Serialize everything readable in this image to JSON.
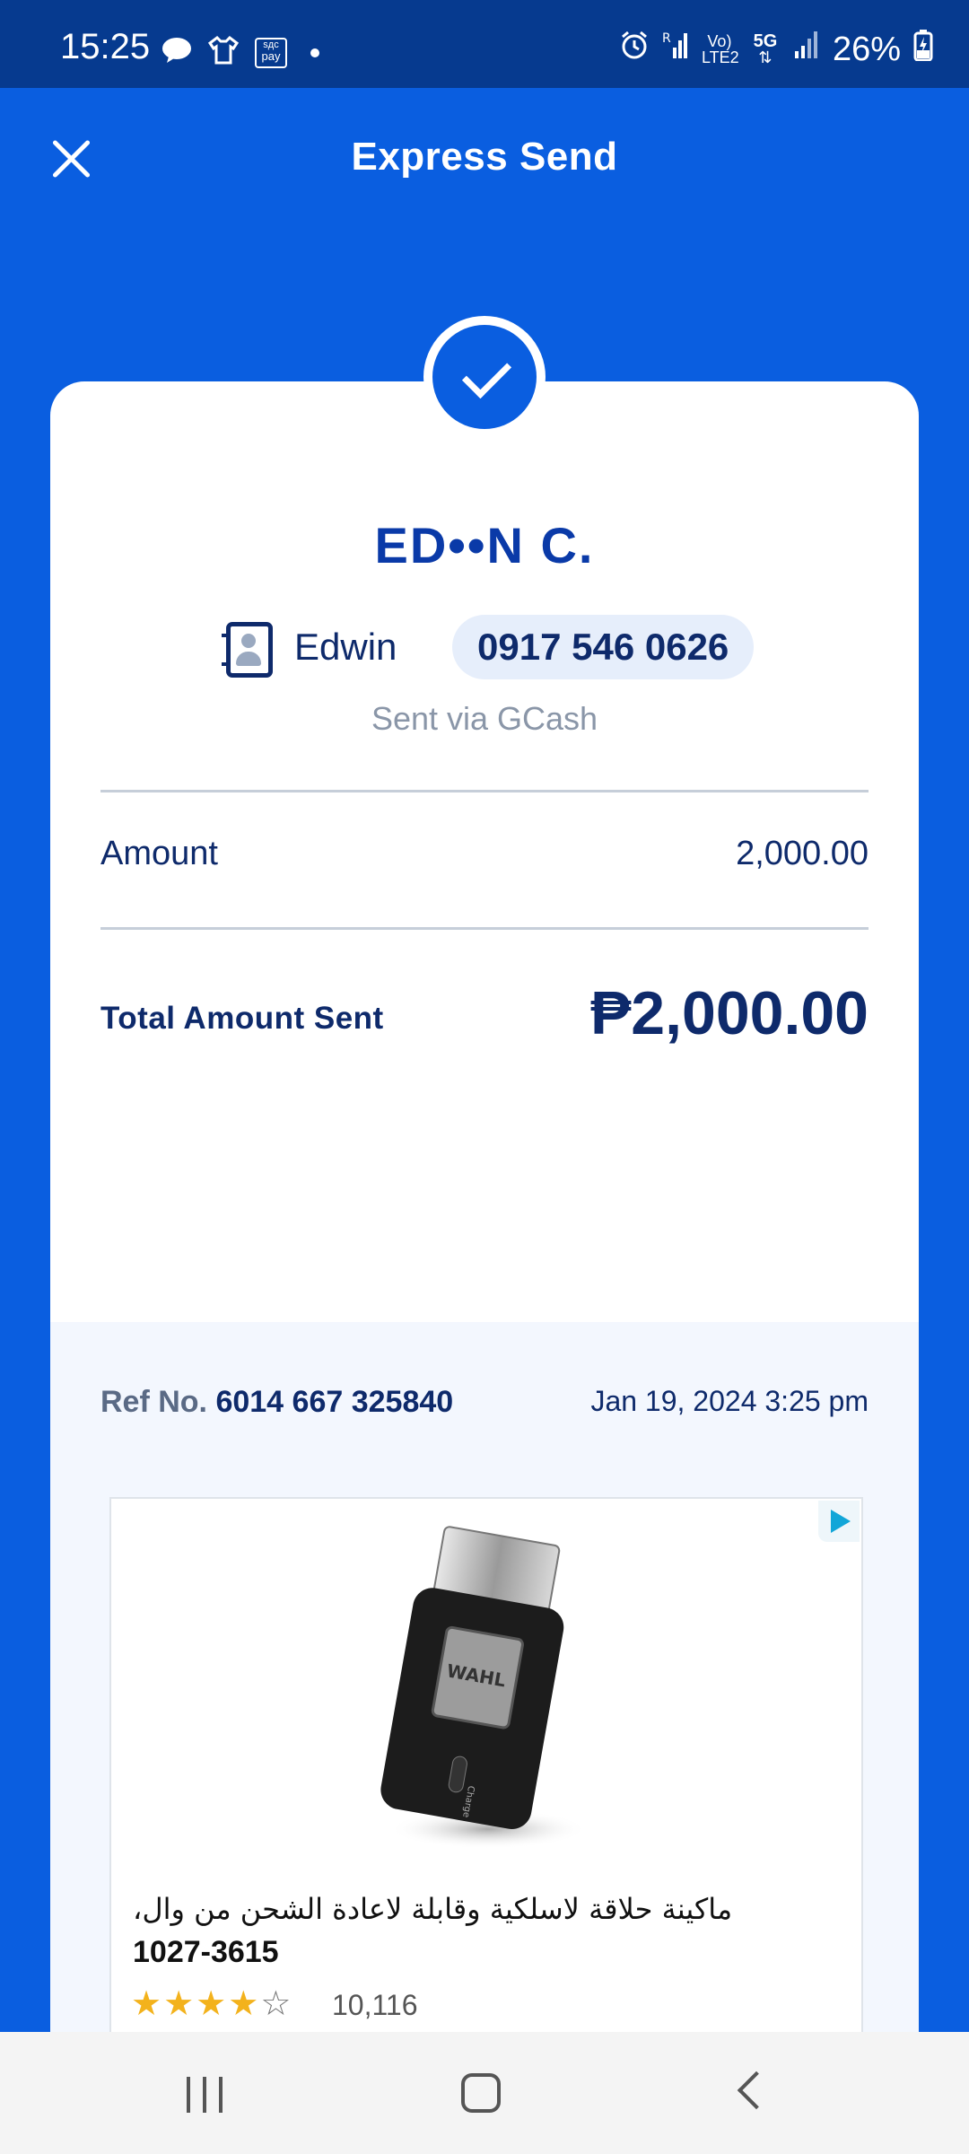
{
  "status_bar": {
    "time": "15:25",
    "battery": "26%",
    "left_icons": [
      "chat-icon",
      "shirt-icon",
      "pay-icon",
      "dot-icon"
    ],
    "right_icons": [
      "alarm-icon",
      "signal-r-icon",
      "volte-icon",
      "5g-icon",
      "signal-icon",
      "battery-charging-icon"
    ],
    "pay_label": "pay",
    "pay_top": "sдc",
    "volte_top": "Vo)",
    "volte_bottom": "LTE2",
    "net": "5G"
  },
  "header": {
    "title": "Express Send"
  },
  "recipient": {
    "masked_name": "ED••N C.",
    "contact_name": "Edwin",
    "phone": "0917 546 0626",
    "sent_via": "Sent via GCash"
  },
  "amount": {
    "label": "Amount",
    "value": "2,000.00"
  },
  "total": {
    "label": "Total Amount Sent",
    "value": "₱2,000.00"
  },
  "reference": {
    "label": "Ref No.",
    "number": "6014 667 325840",
    "datetime": "Jan 19, 2024 3:25 pm"
  },
  "ad": {
    "title": "ماكينة حلاقة لاسلكية وقابلة لاعادة الشحن من وال،",
    "code": "1027-3615",
    "rating": 4,
    "reviews": "10,116",
    "product_brand": "WAHL",
    "product_label": "Charge"
  },
  "colors": {
    "primary": "#0a5ee0",
    "status_bar": "#063a8f",
    "text_dark": "#0e2a6b",
    "accent_name": "#0a3aa8"
  }
}
